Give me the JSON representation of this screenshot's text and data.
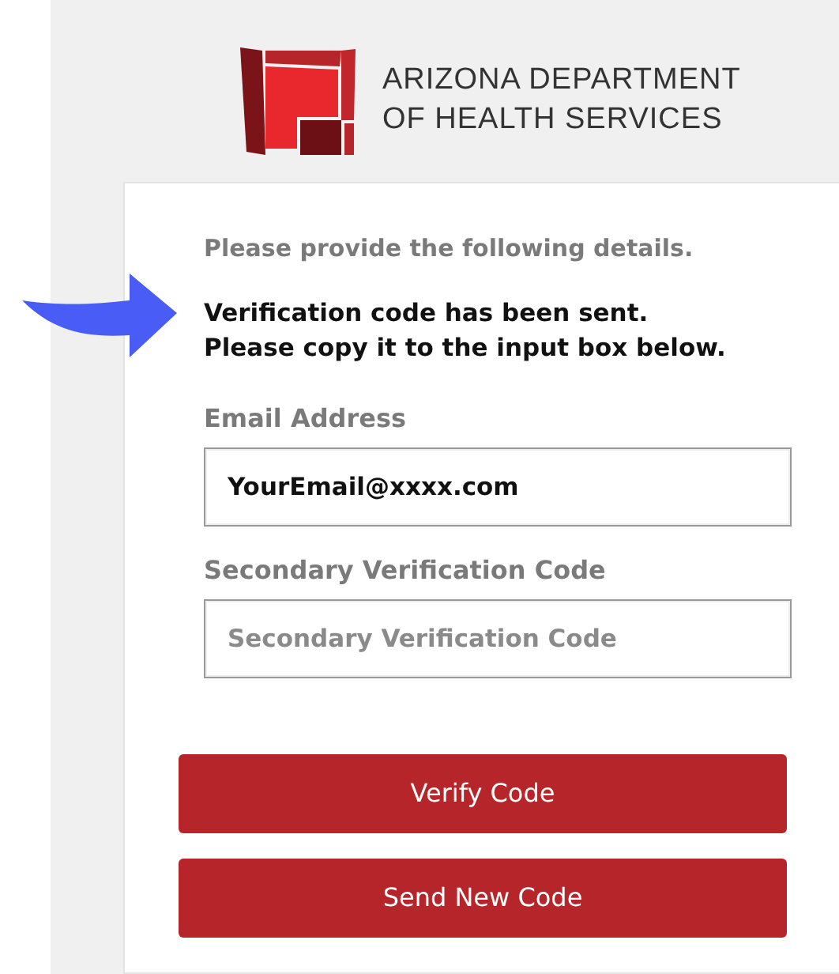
{
  "header": {
    "logo_lines": [
      "ARIZONA DEPARTMENT",
      "OF HEALTH SERVICES"
    ]
  },
  "form": {
    "intro": "Please provide the following details.",
    "notice": [
      "Verification code has been sent.",
      "Please copy it to the input box below."
    ],
    "fields": [
      {
        "label": "Email Address",
        "value": "YourEmail@xxxx.com"
      },
      {
        "label": "Secondary Verification Code",
        "placeholder": "Secondary Verification Code"
      }
    ],
    "buttons": [
      "Verify Code",
      "Send New Code"
    ]
  }
}
